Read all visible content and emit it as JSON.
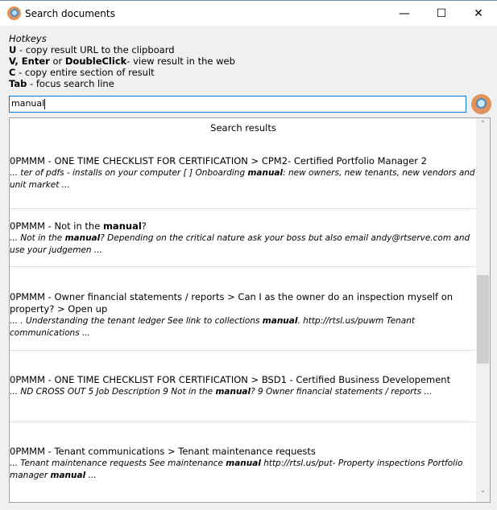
{
  "window": {
    "title": "Search documents",
    "icon": "magnifier-icon",
    "minimize": "—",
    "maximize": "☐",
    "close": "✕"
  },
  "hotkeys": {
    "heading": "Hotkeys",
    "lines": [
      [
        {
          "t": "U",
          "b": true
        },
        {
          "t": " - copy result URL to the clipboard"
        }
      ],
      [
        {
          "t": "V, Enter",
          "b": true
        },
        {
          "t": " or "
        },
        {
          "t": "DoubleClick",
          "b": true
        },
        {
          "t": "- view result in the web"
        }
      ],
      [
        {
          "t": "C",
          "b": true
        },
        {
          "t": " - copy entire section of result"
        }
      ],
      [
        {
          "t": "Tab",
          "b": true
        },
        {
          "t": " - focus search line"
        }
      ]
    ]
  },
  "search": {
    "value": "manual"
  },
  "results": {
    "header": "Search results",
    "items": [
      {
        "title": [
          {
            "t": "0PMMM - ONE TIME CHECKLIST FOR CERTIFICATION > CPM2- Certified Portfolio Manager 2"
          }
        ],
        "snippet": [
          {
            "t": "... ter of pdfs - installs on your computer [ ] Onboarding "
          },
          {
            "t": "manual",
            "b": true
          },
          {
            "t": ": new owners, new tenants, new vendors and unit market ..."
          }
        ]
      },
      {
        "title": [
          {
            "t": "0PMMM - Not in the "
          },
          {
            "t": "manual",
            "b": true
          },
          {
            "t": "?"
          }
        ],
        "snippet": [
          {
            "t": "... Not in the "
          },
          {
            "t": "manual",
            "b": true
          },
          {
            "t": "? Depending on the critical nature ask your boss but also email andy@rtserve.com and use your judgemen ..."
          }
        ]
      },
      {
        "title": [
          {
            "t": "0PMMM - Owner financial statements / reports > Can I as the owner do an inspection myself on property? > Open up"
          }
        ],
        "snippet": [
          {
            "t": "... . Understanding the tenant ledger See link to collections "
          },
          {
            "t": "manual",
            "b": true
          },
          {
            "t": ". http://rtsl.us/puwm Tenant communications ..."
          }
        ]
      },
      {
        "title": [
          {
            "t": "0PMMM - ONE TIME CHECKLIST FOR CERTIFICATION > BSD1 - Certified Business Developement"
          }
        ],
        "snippet": [
          {
            "t": "... ND CROSS OUT 5 Job Description 9 Not in the "
          },
          {
            "t": "manual",
            "b": true
          },
          {
            "t": "? 9 Owner financial statements / reports ..."
          }
        ]
      },
      {
        "title": [
          {
            "t": "0PMMM - Tenant communications > Tenant maintenance requests"
          }
        ],
        "snippet": [
          {
            "t": "... Tenant maintenance requests See maintenance "
          },
          {
            "t": "manual",
            "b": true
          },
          {
            "t": " http://rtsl.us/put- Property inspections Portfolio manager "
          },
          {
            "t": "manual",
            "b": true
          },
          {
            "t": " ..."
          }
        ]
      }
    ]
  },
  "scrollbar": {
    "up": "˄",
    "down": "˅",
    "position_fraction": 0.41
  }
}
